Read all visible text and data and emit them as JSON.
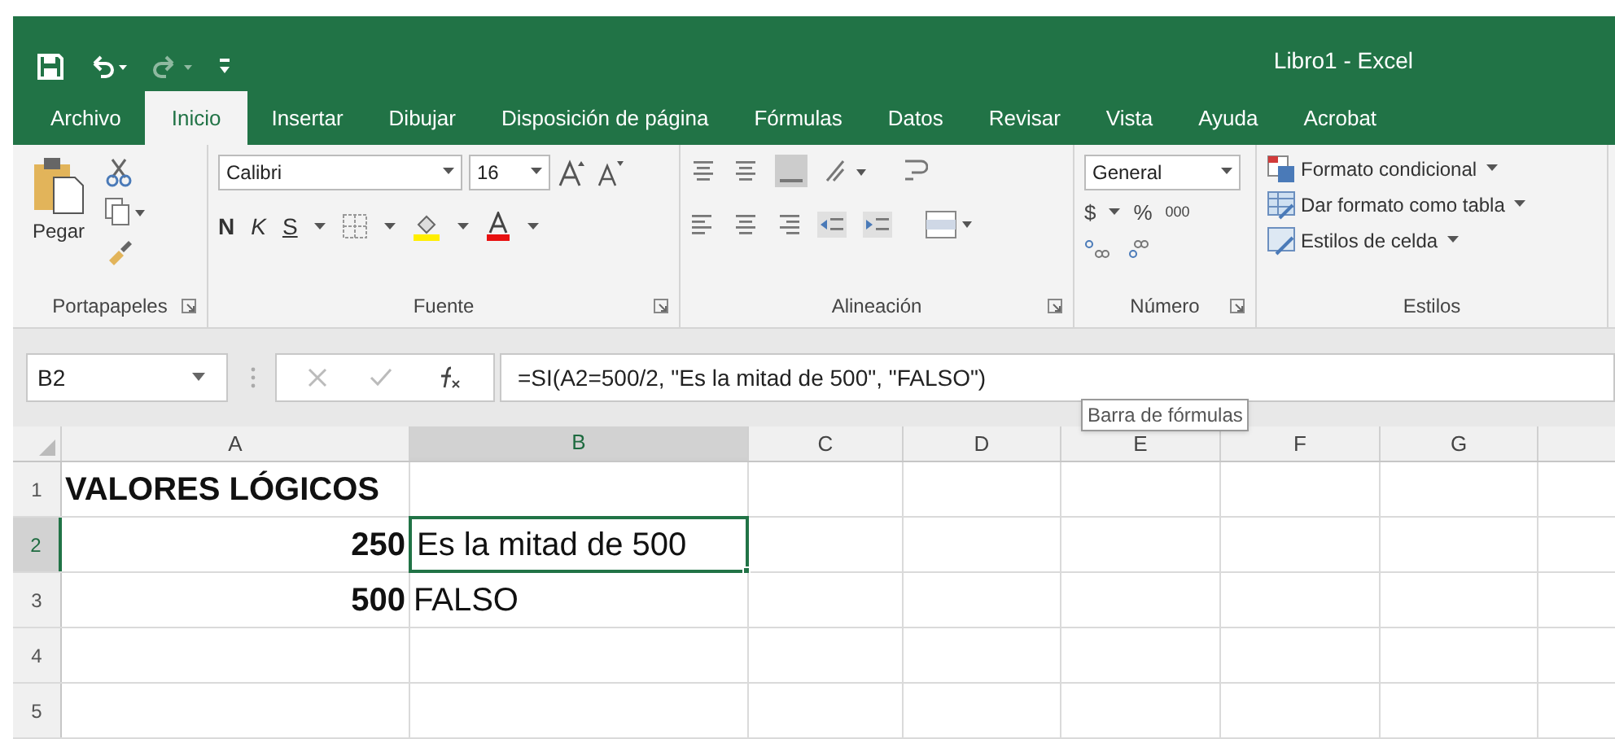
{
  "window": {
    "title": "Libro1  -  Excel"
  },
  "tabs": [
    {
      "label": "Archivo",
      "selected": false
    },
    {
      "label": "Inicio",
      "selected": true
    },
    {
      "label": "Insertar",
      "selected": false
    },
    {
      "label": "Dibujar",
      "selected": false
    },
    {
      "label": "Disposición de página",
      "selected": false
    },
    {
      "label": "Fórmulas",
      "selected": false
    },
    {
      "label": "Datos",
      "selected": false
    },
    {
      "label": "Revisar",
      "selected": false
    },
    {
      "label": "Vista",
      "selected": false
    },
    {
      "label": "Ayuda",
      "selected": false
    },
    {
      "label": "Acrobat",
      "selected": false
    }
  ],
  "ribbon": {
    "clipboard": {
      "label": "Portapapeles",
      "paste": "Pegar"
    },
    "font": {
      "label": "Fuente",
      "font_name": "Calibri",
      "font_size": "16",
      "bold": "N",
      "italic": "K",
      "underline": "S"
    },
    "alignment": {
      "label": "Alineación"
    },
    "number": {
      "label": "Número",
      "format": "General",
      "currency": "$",
      "percent": "%",
      "thousands": "000"
    },
    "styles": {
      "label": "Estilos",
      "commands": [
        "Formato condicional",
        "Dar formato como tabla",
        "Estilos de celda"
      ]
    }
  },
  "formula_bar": {
    "name_box": "B2",
    "formula": "=SI(A2=500/2, \"Es la mitad de 500\", \"FALSO\")",
    "tooltip": "Barra de fórmulas"
  },
  "sheet": {
    "columns": [
      {
        "label": "A",
        "selected": false
      },
      {
        "label": "B",
        "selected": true
      },
      {
        "label": "C",
        "selected": false
      },
      {
        "label": "D",
        "selected": false
      },
      {
        "label": "E",
        "selected": false
      },
      {
        "label": "F",
        "selected": false
      },
      {
        "label": "G",
        "selected": false
      }
    ],
    "rows": [
      {
        "label": "1",
        "selected": false,
        "col_a": {
          "text": "VALORES LÓGICOS",
          "kind": "text",
          "bold": true,
          "selected": false
        }
      },
      {
        "label": "2",
        "selected": true,
        "col_a": {
          "text": "250",
          "kind": "number",
          "bold": true,
          "selected": false
        },
        "col_b": {
          "text": "Es la mitad de 500",
          "kind": "text",
          "bold": false,
          "selected": true
        }
      },
      {
        "label": "3",
        "selected": false,
        "col_a": {
          "text": "500",
          "kind": "number",
          "bold": true,
          "selected": false
        },
        "col_b": {
          "text": "FALSO",
          "kind": "text",
          "bold": false,
          "selected": false
        }
      },
      {
        "label": "4",
        "selected": false
      },
      {
        "label": "5",
        "selected": false
      }
    ]
  }
}
